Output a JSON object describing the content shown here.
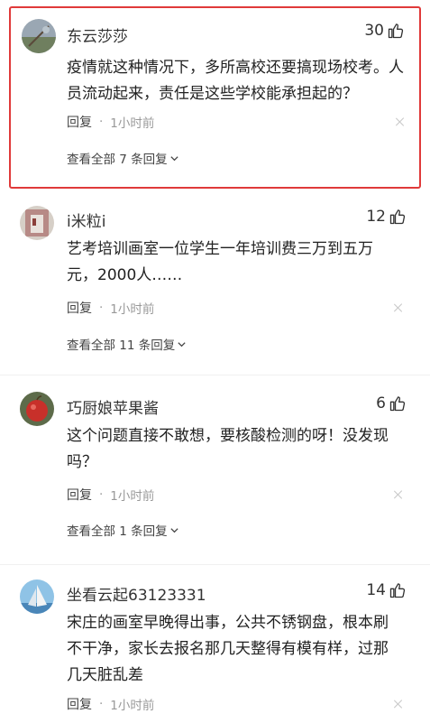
{
  "comments": [
    {
      "username": "东云莎莎",
      "likes": "30",
      "text": "疫情就这种情况下，多所高校还要搞现场校考。人员流动起来，责任是这些学校能承担起的？",
      "reply_label": "回复",
      "time": "1小时前",
      "view_all": "查看全部 7 条回复"
    },
    {
      "username": "i米粒i",
      "likes": "12",
      "text": "艺考培训画室一位学生一年培训费三万到五万元，2000人……",
      "reply_label": "回复",
      "time": "1小时前",
      "view_all": "查看全部 11 条回复"
    },
    {
      "username": "巧厨娘苹果酱",
      "likes": "6",
      "text": "这个问题直接不敢想，要核酸检测的呀！没发现吗？",
      "reply_label": "回复",
      "time": "1小时前",
      "view_all": "查看全部 1 条回复"
    },
    {
      "username": "坐看云起63123331",
      "likes": "14",
      "text": "宋庄的画室早晚得出事，公共不锈钢盘，根本刷不干净，家长去报名那几天整得有模有样，过那几天脏乱差",
      "reply_label": "回复",
      "time": "1小时前"
    }
  ],
  "colors": {
    "highlight": "#e03a3a"
  },
  "icons": {
    "like": "thumbs-up-icon",
    "dismiss": "close-icon",
    "expand": "chevron-down-icon"
  }
}
